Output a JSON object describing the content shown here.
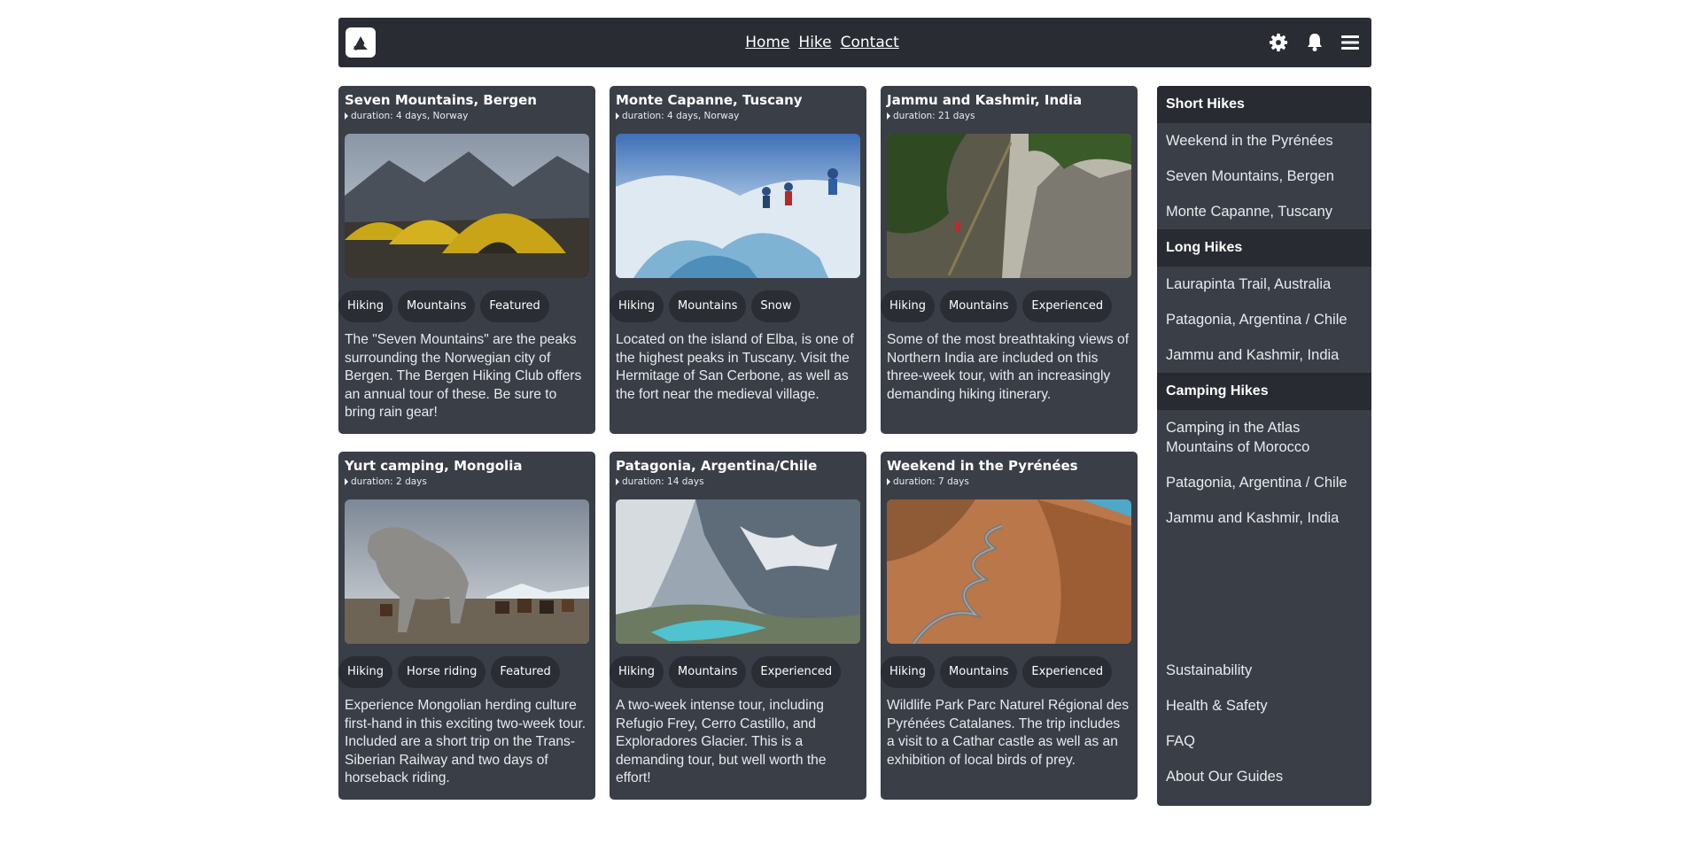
{
  "nav": {
    "links": [
      "Home",
      "Hike",
      "Contact"
    ],
    "icons": [
      "gear-icon",
      "bell-icon",
      "hamburger-menu-icon"
    ]
  },
  "cards": [
    {
      "title": "Seven Mountains, Bergen",
      "duration": "duration: 4 days, Norway",
      "tags": [
        "Hiking",
        "Mountains",
        "Featured"
      ],
      "description": "The \"Seven Mountains\" are the peaks surrounding the Norwegian city of Bergen. The Bergen Hiking Club offers an annual tour of these. Be sure to bring rain gear!"
    },
    {
      "title": "Monte Capanne, Tuscany",
      "duration": "duration: 4 days, Norway",
      "tags": [
        "Hiking",
        "Mountains",
        "Snow"
      ],
      "description": "Located on the island of Elba, is one of the highest peaks in Tuscany. Visit the Hermitage of San Cerbone, as well as the fort near the medieval village."
    },
    {
      "title": "Jammu and Kashmir, India",
      "duration": "duration: 21 days",
      "tags": [
        "Hiking",
        "Mountains",
        "Experienced"
      ],
      "description": "Some of the most breathtaking views of Northern India are included on this three-week tour, with an increasingly demanding hiking itinerary."
    },
    {
      "title": "Yurt camping, Mongolia",
      "duration": "duration: 2 days",
      "tags": [
        "Hiking",
        "Horse riding",
        "Featured"
      ],
      "description": "Experience Mongolian herding culture first-hand in this exciting two-week tour. Included are a short trip on the Trans-Siberian Railway and two days of horseback riding."
    },
    {
      "title": "Patagonia, Argentina/Chile",
      "duration": "duration: 14 days",
      "tags": [
        "Hiking",
        "Mountains",
        "Experienced"
      ],
      "description": "A two-week intense tour, including Refugio Frey, Cerro Castillo, and Exploradores Glacier. This is a demanding tour, but well worth the effort!"
    },
    {
      "title": "Weekend in the Pyrénées",
      "duration": "duration: 7 days",
      "tags": [
        "Hiking",
        "Mountains",
        "Experienced"
      ],
      "description": "Wildlife Park Parc Naturel Régional des Pyrénées Catalanes. The trip includes a visit to a Cathar castle as well as an exhibition of local birds of prey."
    }
  ],
  "sidebar": {
    "sections": [
      {
        "heading": "Short Hikes",
        "items": [
          "Weekend in the Pyrénées",
          "Seven Mountains, Bergen",
          "Monte Capanne, Tuscany"
        ]
      },
      {
        "heading": "Long Hikes",
        "items": [
          "Laurapinta Trail, Australia",
          "Patagonia, Argentina / Chile",
          "Jammu and Kashmir, India"
        ]
      },
      {
        "heading": "Camping Hikes",
        "items": [
          "Camping in the Atlas Mountains of Morocco",
          "Patagonia, Argentina / Chile",
          "Jammu and Kashmir, India"
        ]
      }
    ],
    "footer_links": [
      "Sustainability",
      "Health & Safety",
      "FAQ",
      "About Our Guides"
    ]
  }
}
